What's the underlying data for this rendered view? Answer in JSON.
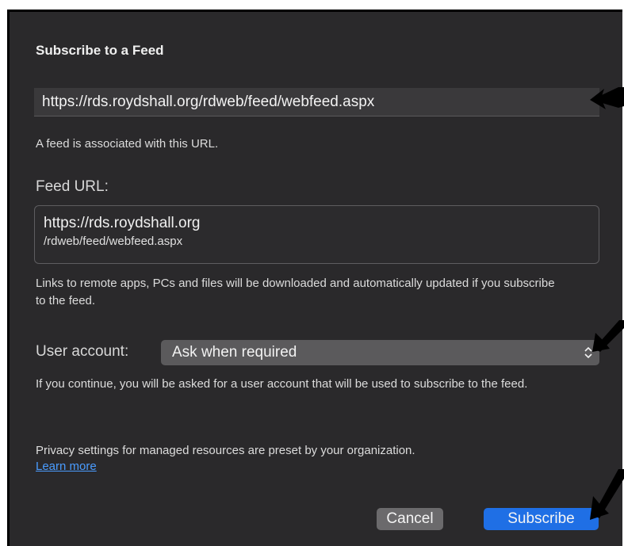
{
  "dialog": {
    "title": "Subscribe to a Feed",
    "url_value": "https://rds.roydshall.org/rdweb/feed/webfeed.aspx",
    "url_note": "A feed is associated with this URL.",
    "feed_url_label": "Feed URL:",
    "feed_url_line1": "https://rds.roydshall.org",
    "feed_url_line2": "/rdweb/feed/webfeed.aspx",
    "links_note": "Links to remote apps, PCs and files will be downloaded and automatically updated if you subscribe to the feed.",
    "user_account_label": "User account:",
    "user_account_value": "Ask when required",
    "continue_note": "If you continue, you will be asked for a user account that will be used to subscribe to the feed.",
    "privacy_note": "Privacy settings for managed resources are preset by your organization.",
    "learn_more": "Learn more",
    "cancel_label": "Cancel",
    "subscribe_label": "Subscribe"
  },
  "colors": {
    "background": "#2a292b",
    "accent": "#1f6fe5",
    "link": "#4a9cff"
  },
  "icons": [
    "updown-chevron-icon",
    "arrow-pointer-icon"
  ]
}
